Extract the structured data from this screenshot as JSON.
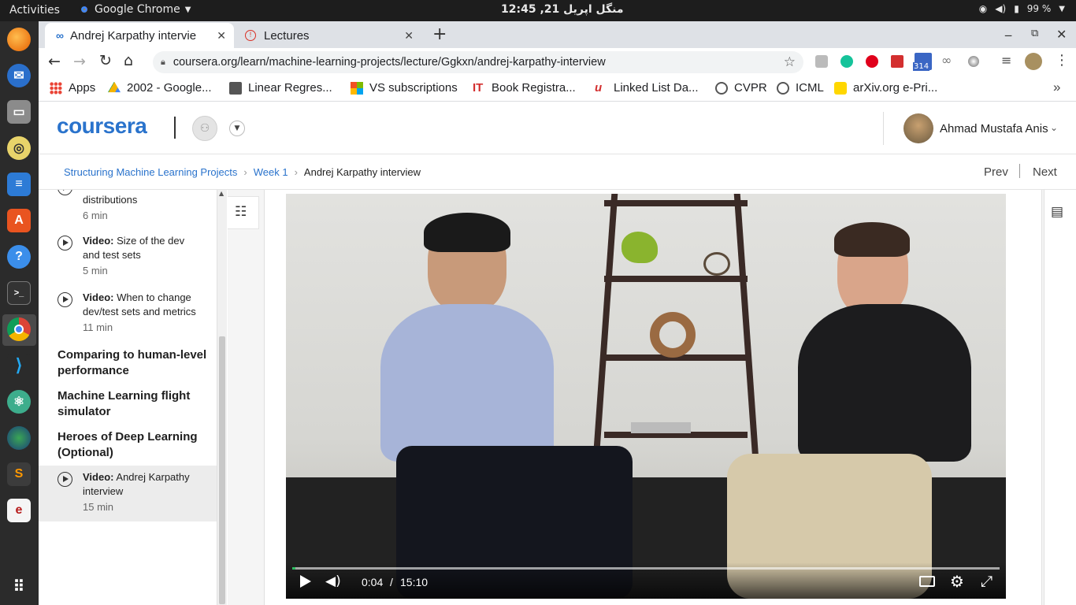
{
  "system": {
    "activities": "Activities",
    "app_name": "Google Chrome",
    "clock": "منگل اپریل 21, 12:45",
    "battery": "99 %"
  },
  "browser": {
    "tabs": [
      {
        "label": "Andrej Karpathy intervie"
      },
      {
        "label": "Lectures"
      }
    ],
    "url": "coursera.org/learn/machine-learning-projects/lecture/Ggkxn/andrej-karpathy-interview",
    "extension_badge": "314",
    "bookmarks": [
      {
        "label": "Apps"
      },
      {
        "label": "2002 - Google..."
      },
      {
        "label": "Linear Regres..."
      },
      {
        "label": "VS subscriptions"
      },
      {
        "label": "Book Registra..."
      },
      {
        "label": "Linked List Da..."
      },
      {
        "label": "CVPR"
      },
      {
        "label": "ICML"
      },
      {
        "label": "arXiv.org e-Pri..."
      }
    ]
  },
  "coursera": {
    "logo": "coursera",
    "user_name": "Ahmad Mustafa Anis",
    "breadcrumb": [
      "Structuring Machine Learning Projects",
      "Week 1",
      "Andrej Karpathy interview"
    ],
    "prev": "Prev",
    "next": "Next",
    "sidebar": {
      "top_partial": {
        "title": "distributions",
        "duration": "6 min"
      },
      "items": [
        {
          "kind": "Video:",
          "title": " Size of the dev and test sets",
          "duration": "5 min"
        },
        {
          "kind": "Video:",
          "title": " When to change dev/test sets and metrics",
          "duration": "11 min"
        }
      ],
      "sections": [
        "Comparing to human-level performance",
        "Machine Learning flight simulator",
        "Heroes of Deep Learning (Optional)"
      ],
      "active_item": {
        "kind": "Video:",
        "title": " Andrej Karpathy interview",
        "duration": "15 min"
      }
    },
    "player": {
      "current_time": "0:04",
      "separator": "/",
      "total_time": "15:10",
      "progress": 0.004
    }
  }
}
